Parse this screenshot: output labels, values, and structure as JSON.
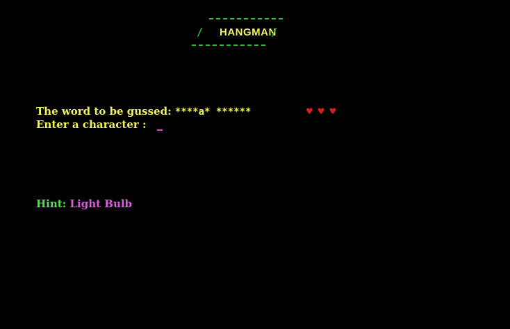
{
  "game": {
    "title": "HANGMAN",
    "slash_left": "/",
    "slash_right": "/",
    "word_label": "The word to be gussed:",
    "masked_word": "****a* ******",
    "enter_label": "Enter a character :",
    "lives_remaining": 3,
    "heart_glyph": "♥",
    "hint_label": "Hint:",
    "hint_value": "Light Bulb"
  },
  "colors": {
    "background": "#000000",
    "title": "#f2f25c",
    "border": "#2fbf3a",
    "text": "#f2f25c",
    "hearts": "#d42020",
    "hint_label": "#55e055",
    "hint_value": "#e05ae0",
    "cursor": "#d24bd2"
  }
}
